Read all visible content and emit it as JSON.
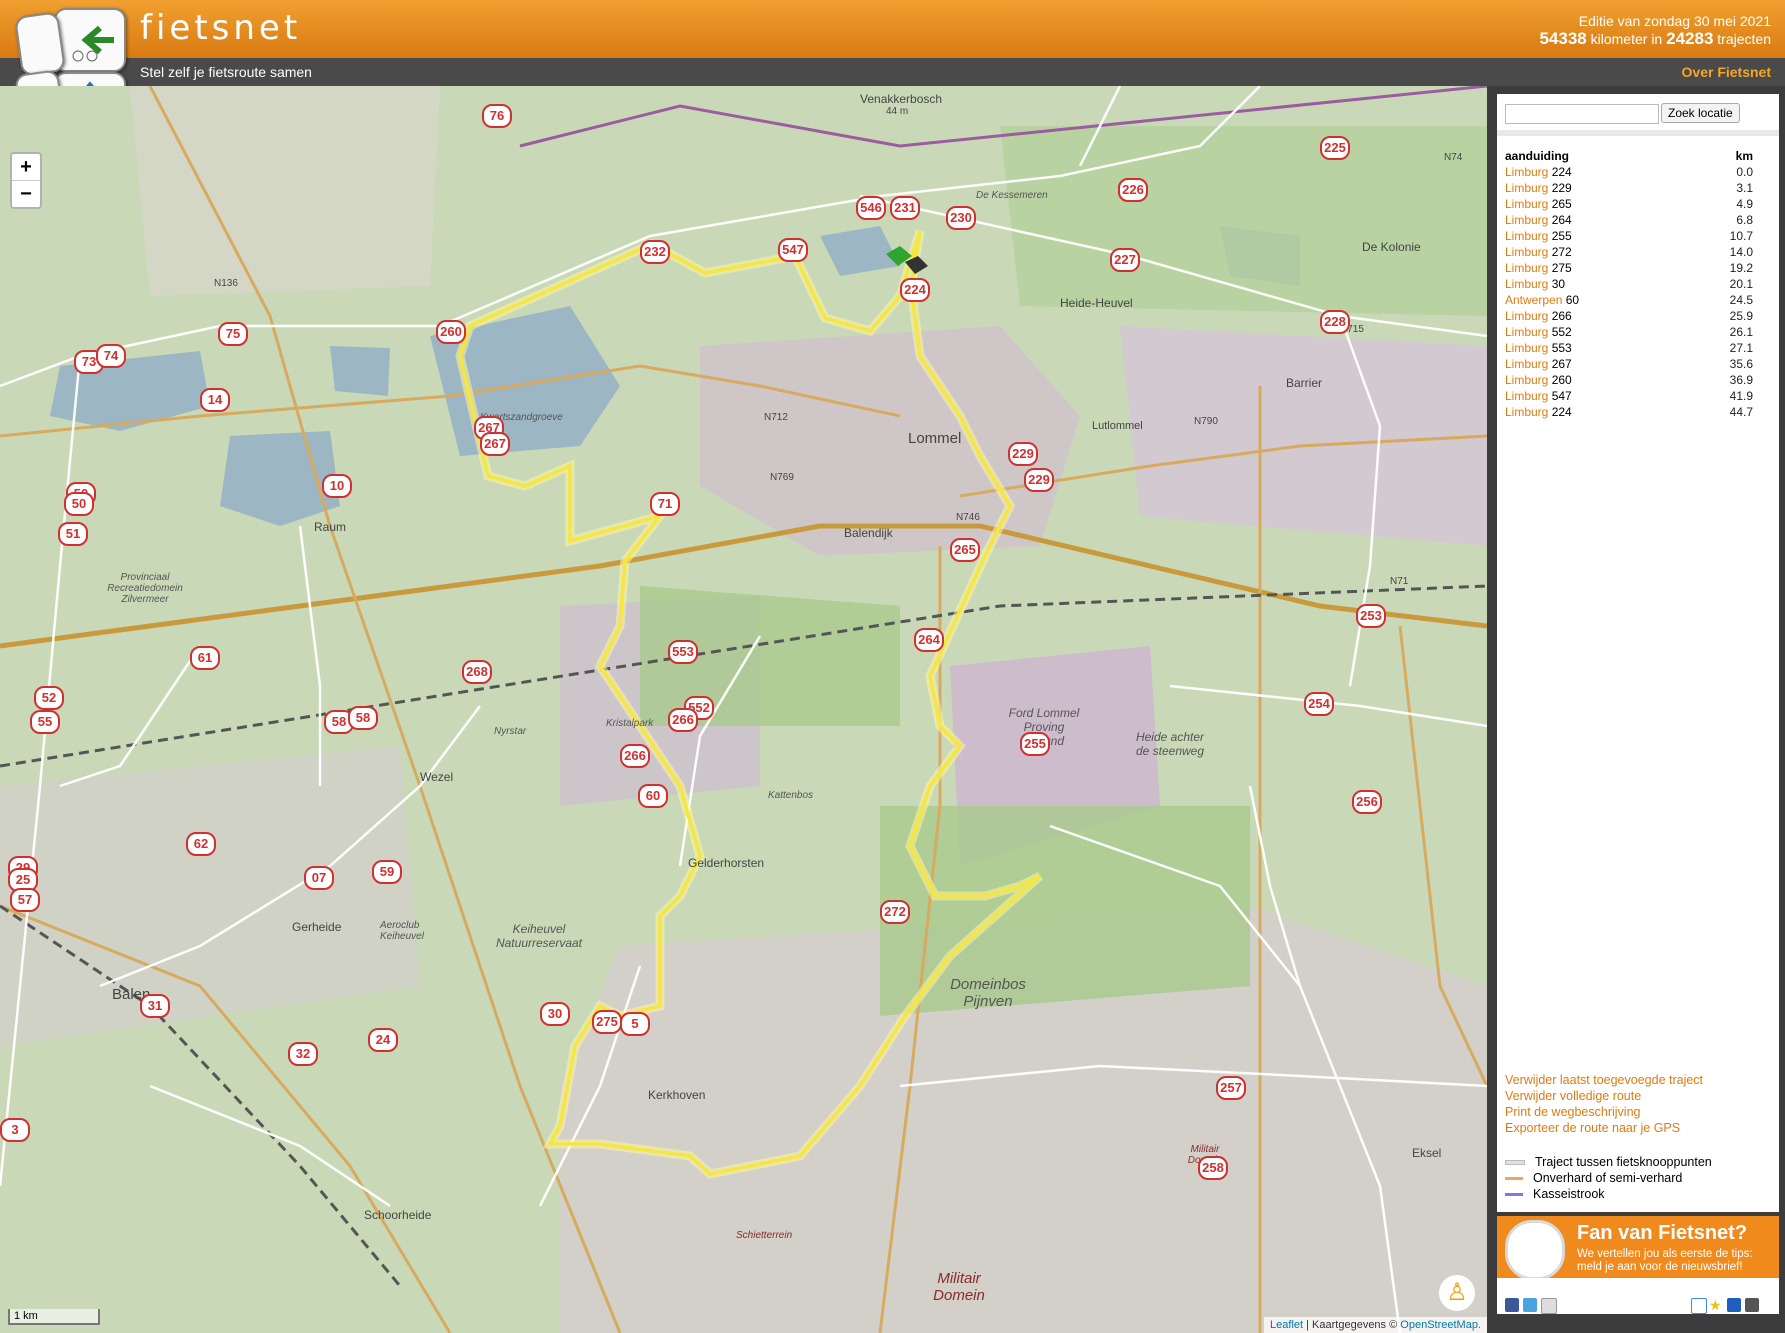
{
  "header": {
    "logo": "fietsnet",
    "edition_text": "Editie van zondag 30 mei 2021",
    "km_count": "54338",
    "km_label": "kilometer in",
    "trajects_count": "24283",
    "trajects_label": "trajecten",
    "tagline": "Stel zelf je fietsroute samen",
    "about_link": "Over Fietsnet"
  },
  "colors": {
    "header_orange": "#e8901c",
    "route_yellow": "#f5e642",
    "node_red": "#d03030",
    "link_orange": "#e07a10"
  },
  "map": {
    "zoom_in": "+",
    "zoom_out": "−",
    "scale": "1 km",
    "attribution_leaflet": "Leaflet",
    "attribution_text": "| Kaartgegevens ©",
    "attribution_osm": "OpenStreetMap.",
    "labels": {
      "venakkerbosch": "Venakkerbosch",
      "venakker_height": "44 m",
      "kessemeren": "De Kessemeren",
      "kolonie": "De Kolonie",
      "heide_heuvel": "Heide-Heuvel",
      "barrier": "Barrier",
      "lommel": "Lommel",
      "lutlommel": "Lutlommel",
      "balendijk": "Balendijk",
      "kwartszandgroeve": "Kwartszandgroeve",
      "kristalpark": "Kristalpark",
      "nyrstar": "Nyrstar",
      "wezel": "Wezel",
      "raum": "Raum",
      "gerheide": "Gerheide",
      "balen": "Balen",
      "gelderhorsten": "Gelderhorsten",
      "kattenbos": "Kattenbos",
      "ford": "Ford Lommel Proving Ground",
      "heide_achter": "Heide achter de steenweg",
      "domeinbos": "Domeinbos Pijnven",
      "kerkhoven": "Kerkhoven",
      "schoorheide": "Schoorheide",
      "militair_domein": "Militair Domein",
      "militair_domein_small": "Militair Domein",
      "schietterrein": "Schietterrein",
      "aeroclub": "Aeroclub Keiheuvel",
      "keiheuvel": "Keiheuvel Natuurreservaat",
      "eksel": "Eksel",
      "provinciaal": "Provinciaal Recreatiedomein Zilvermeer",
      "n712": "N712",
      "n769": "N769",
      "n746": "N746",
      "n136": "N136",
      "n715": "N715",
      "n74": "N74",
      "n71": "N71",
      "n790": "N790"
    },
    "nodes": [
      "76",
      "225",
      "226",
      "546",
      "231",
      "230",
      "232",
      "547",
      "227",
      "224",
      "228",
      "260",
      "75",
      "73",
      "74",
      "14",
      "267",
      "267",
      "229",
      "229",
      "10",
      "50",
      "50",
      "51",
      "265",
      "253",
      "264",
      "553",
      "61",
      "268",
      "52",
      "55",
      "58",
      "58",
      "552",
      "266",
      "266",
      "255",
      "254",
      "60",
      "256",
      "62",
      "29",
      "25",
      "57",
      "07",
      "59",
      "272",
      "31",
      "24",
      "32",
      "30",
      "275",
      "5",
      "257",
      "258",
      "3",
      "71",
      "226"
    ]
  },
  "sidebar": {
    "search_placeholder": "",
    "search_button": "Zoek locatie",
    "table_header_label": "aanduiding",
    "table_header_km": "km",
    "rows": [
      {
        "prov": "Limburg",
        "node": "224",
        "km": "0.0"
      },
      {
        "prov": "Limburg",
        "node": "229",
        "km": "3.1"
      },
      {
        "prov": "Limburg",
        "node": "265",
        "km": "4.9"
      },
      {
        "prov": "Limburg",
        "node": "264",
        "km": "6.8"
      },
      {
        "prov": "Limburg",
        "node": "255",
        "km": "10.7"
      },
      {
        "prov": "Limburg",
        "node": "272",
        "km": "14.0"
      },
      {
        "prov": "Limburg",
        "node": "275",
        "km": "19.2"
      },
      {
        "prov": "Limburg",
        "node": "30",
        "km": "20.1"
      },
      {
        "prov": "Antwerpen",
        "node": "60",
        "km": "24.5"
      },
      {
        "prov": "Limburg",
        "node": "266",
        "km": "25.9"
      },
      {
        "prov": "Limburg",
        "node": "552",
        "km": "26.1"
      },
      {
        "prov": "Limburg",
        "node": "553",
        "km": "27.1"
      },
      {
        "prov": "Limburg",
        "node": "267",
        "km": "35.6"
      },
      {
        "prov": "Limburg",
        "node": "260",
        "km": "36.9"
      },
      {
        "prov": "Limburg",
        "node": "547",
        "km": "41.9"
      },
      {
        "prov": "Limburg",
        "node": "224",
        "km": "44.7"
      }
    ],
    "actions": [
      "Verwijder laatst toegevoegde traject",
      "Verwijder volledige route",
      "Print de wegbeschrijving",
      "Exporteer de route naar je GPS"
    ],
    "legend": [
      {
        "label": "Traject tussen fietsknooppunten",
        "color": "#e6e6e6"
      },
      {
        "label": "Onverhard of semi-verhard",
        "color": "#f4a460"
      },
      {
        "label": "Kasseistrook",
        "color": "#7a7ae6"
      }
    ]
  },
  "fan": {
    "title": "Fan van Fietsnet?",
    "line1": "We vertellen jou als eerste de tips:",
    "line2": "meld je aan voor de nieuwsbrief!"
  }
}
